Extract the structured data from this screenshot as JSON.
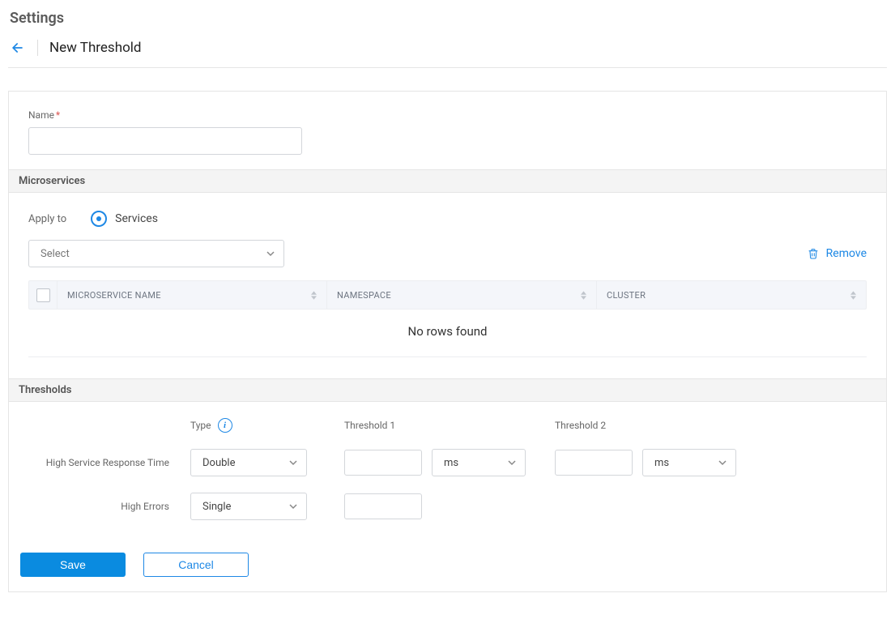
{
  "page": {
    "title": "Settings"
  },
  "breadcrumb": {
    "current": "New Threshold"
  },
  "nameField": {
    "label": "Name",
    "value": ""
  },
  "sections": {
    "microservices": "Microservices",
    "thresholds": "Thresholds"
  },
  "applyTo": {
    "label": "Apply to",
    "option_services": "Services"
  },
  "selectPlaceholder": "Select",
  "removeLabel": "Remove",
  "table": {
    "headers": {
      "microservice": "MICROSERVICE NAME",
      "namespace": "NAMESPACE",
      "cluster": "CLUSTER"
    },
    "empty": "No rows found"
  },
  "thresholds": {
    "typeLabel": "Type",
    "col1": "Threshold 1",
    "col2": "Threshold 2",
    "rows": {
      "responseTime": {
        "label": "High Service Response Time",
        "type": "Double",
        "unit1": "ms",
        "unit2": "ms"
      },
      "errors": {
        "label": "High Errors",
        "type": "Single"
      }
    }
  },
  "buttons": {
    "save": "Save",
    "cancel": "Cancel"
  }
}
